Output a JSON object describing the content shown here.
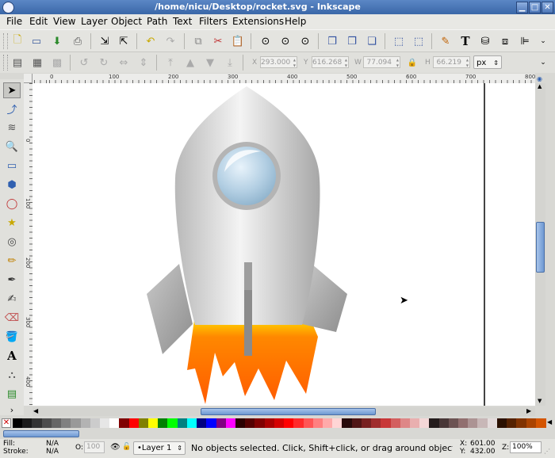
{
  "window": {
    "title": "/home/nicu/Desktop/rocket.svg - Inkscape"
  },
  "menu": [
    "File",
    "Edit",
    "View",
    "Layer",
    "Object",
    "Path",
    "Text",
    "Filters",
    "Extensions",
    "Help"
  ],
  "toolbar": {
    "x_label": "X",
    "x_value": "293.000",
    "y_label": "Y",
    "y_value": "616.268",
    "w_label": "W",
    "w_value": "77.094",
    "h_label": "H",
    "h_value": "66.219",
    "unit": "px"
  },
  "ruler": {
    "labels": [
      "0",
      "100",
      "200",
      "300",
      "400",
      "500",
      "600",
      "700",
      "800"
    ],
    "vlabels": [
      "0",
      "100",
      "200",
      "300",
      "400",
      "500"
    ]
  },
  "status": {
    "fill_label": "Fill:",
    "fill_value": "N/A",
    "stroke_label": "Stroke:",
    "stroke_value": "N/A",
    "opacity_label": "O:",
    "opacity_value": "100",
    "layer": "•Layer 1",
    "message": "No objects selected. Click, Shift+click, or drag around objects to ...",
    "cursor_x_label": "X:",
    "cursor_x": "601.00",
    "cursor_y_label": "Y:",
    "cursor_y": "432.00",
    "zoom_label": "Z:",
    "zoom": "100%"
  },
  "palette": [
    "#000000",
    "#1a1a1a",
    "#333333",
    "#4d4d4d",
    "#666666",
    "#808080",
    "#999999",
    "#b3b3b3",
    "#cccccc",
    "#e6e6e6",
    "#ffffff",
    "#800000",
    "#ff0000",
    "#808000",
    "#ffff00",
    "#008000",
    "#00ff00",
    "#008080",
    "#00ffff",
    "#000080",
    "#0000ff",
    "#800080",
    "#ff00ff",
    "#2b0000",
    "#550000",
    "#800000",
    "#aa0000",
    "#d40000",
    "#ff0000",
    "#ff2a2a",
    "#ff5555",
    "#ff8080",
    "#ffaaaa",
    "#ffd5d5",
    "#280b0b",
    "#501616",
    "#782121",
    "#a02c2c",
    "#c83737",
    "#d35f5f",
    "#de8787",
    "#e9afaf",
    "#f4d7d7",
    "#241c1c",
    "#483737",
    "#6c5353",
    "#916f6f",
    "#ac9393",
    "#c8b7b7",
    "#e3dbdb",
    "#2b1100",
    "#552200",
    "#803300",
    "#aa4400",
    "#d45500"
  ]
}
